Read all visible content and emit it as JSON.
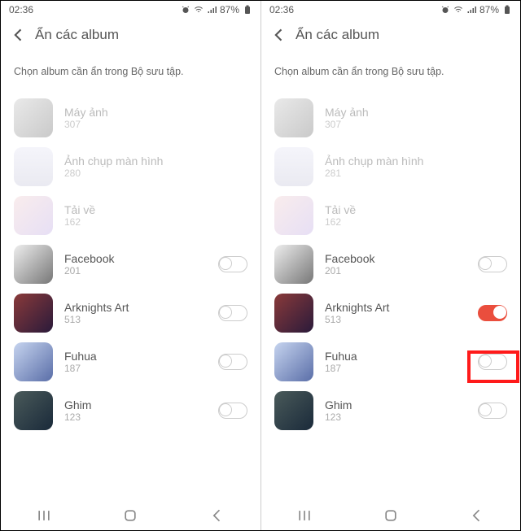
{
  "status": {
    "time": "02:36",
    "battery": "87%"
  },
  "header": {
    "title": "Ẩn các album"
  },
  "subtitle": "Chọn album cần ẩn trong Bộ sưu tập.",
  "panes": [
    {
      "albums": [
        {
          "name": "Máy ảnh",
          "count": "307",
          "disabled": true,
          "toggle": null
        },
        {
          "name": "Ảnh chụp màn hình",
          "count": "280",
          "disabled": true,
          "toggle": null
        },
        {
          "name": "Tải về",
          "count": "162",
          "disabled": true,
          "toggle": null
        },
        {
          "name": "Facebook",
          "count": "201",
          "disabled": false,
          "toggle": false
        },
        {
          "name": "Arknights Art",
          "count": "513",
          "disabled": false,
          "toggle": false
        },
        {
          "name": "Fuhua",
          "count": "187",
          "disabled": false,
          "toggle": false
        },
        {
          "name": "Ghim",
          "count": "123",
          "disabled": false,
          "toggle": false
        }
      ]
    },
    {
      "albums": [
        {
          "name": "Máy ảnh",
          "count": "307",
          "disabled": true,
          "toggle": null
        },
        {
          "name": "Ảnh chụp màn hình",
          "count": "281",
          "disabled": true,
          "toggle": null
        },
        {
          "name": "Tải về",
          "count": "162",
          "disabled": true,
          "toggle": null
        },
        {
          "name": "Facebook",
          "count": "201",
          "disabled": false,
          "toggle": false
        },
        {
          "name": "Arknights Art",
          "count": "513",
          "disabled": false,
          "toggle": true
        },
        {
          "name": "Fuhua",
          "count": "187",
          "disabled": false,
          "toggle": false
        },
        {
          "name": "Ghim",
          "count": "123",
          "disabled": false,
          "toggle": false
        }
      ]
    }
  ]
}
